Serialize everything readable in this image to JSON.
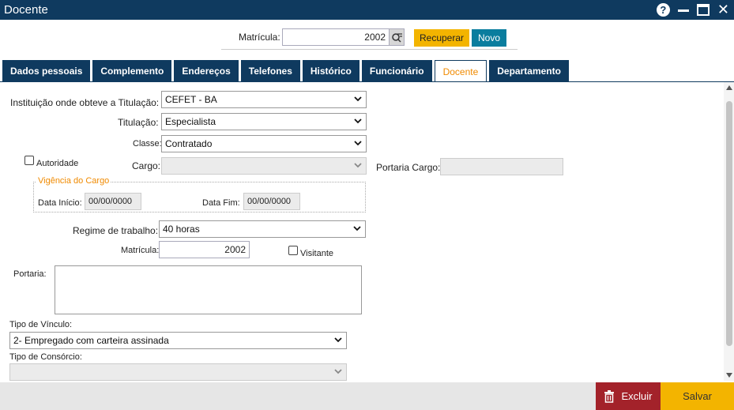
{
  "window": {
    "title": "Docente"
  },
  "top": {
    "matricula_label": "Matrícula:",
    "matricula_value": "2002",
    "recuperar_label": "Recuperar",
    "novo_label": "Novo"
  },
  "tabs": [
    {
      "label": "Dados pessoais"
    },
    {
      "label": "Complemento"
    },
    {
      "label": "Endereços"
    },
    {
      "label": "Telefones"
    },
    {
      "label": "Histórico"
    },
    {
      "label": "Funcionário"
    },
    {
      "label": "Docente",
      "active": true
    },
    {
      "label": "Departamento"
    }
  ],
  "form": {
    "instituicao_label": "Instituição onde obteve a Titulação:",
    "instituicao_value": "CEFET - BA",
    "titulacao_label": "Titulação:",
    "titulacao_value": "Especialista",
    "classe_label": "Classe:",
    "classe_value": "Contratado",
    "autoridade_label": "Autoridade",
    "cargo_label": "Cargo:",
    "cargo_value": "",
    "portaria_cargo_label": "Portaria Cargo:",
    "vigencia_legend": "Vigência do Cargo",
    "data_inicio_label": "Data Início:",
    "data_inicio_value": "00/00/0000",
    "data_fim_label": "Data Fim:",
    "data_fim_value": "00/00/0000",
    "regime_label": "Regime de trabalho:",
    "regime_value": "40 horas",
    "matricula_label": "Matrícula:",
    "matricula_value": "2002",
    "visitante_label": "Visitante",
    "portaria_label": "Portaria:",
    "tipo_vinculo_label": "Tipo de Vínculo:",
    "tipo_vinculo_value": "2- Empregado com carteira assinada",
    "tipo_consorcio_label": "Tipo de Consórcio:",
    "tipo_consorcio_value": ""
  },
  "footer": {
    "excluir_label": "Excluir",
    "salvar_label": "Salvar"
  },
  "colors": {
    "titlebar": "#0f3a5f",
    "accent_yellow": "#f3b400",
    "accent_teal": "#0a7d9e",
    "danger": "#a3222a",
    "active_tab_text": "#f08a00"
  }
}
